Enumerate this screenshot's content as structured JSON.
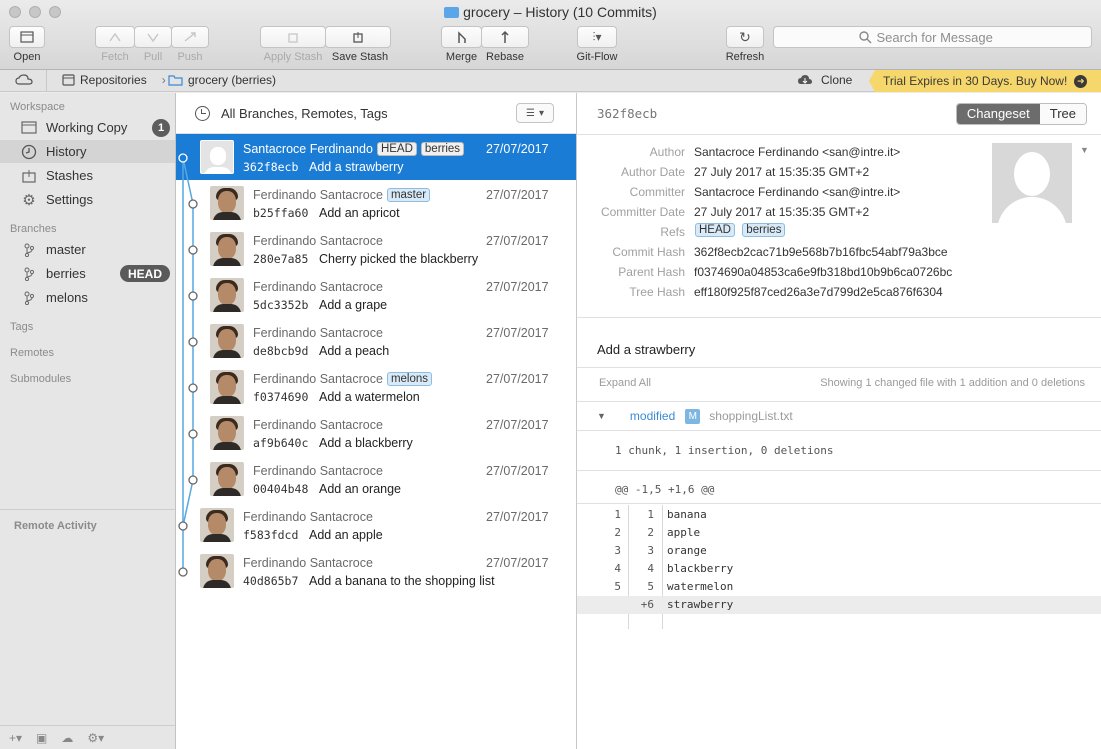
{
  "window": {
    "title": "grocery – History (10 Commits)"
  },
  "toolbar": {
    "open": "Open",
    "fetch": "Fetch",
    "pull": "Pull",
    "push": "Push",
    "apply_stash": "Apply Stash",
    "save_stash": "Save Stash",
    "merge": "Merge",
    "rebase": "Rebase",
    "gitflow": "Git-Flow",
    "refresh": "Refresh",
    "search_placeholder": "Search for Message"
  },
  "breadcrumb": {
    "repositories": "Repositories",
    "repo": "grocery (berries)",
    "clone": "Clone",
    "trial": "Trial Expires in 30 Days. Buy Now!"
  },
  "sidebar": {
    "workspace_title": "Workspace",
    "workspace": [
      {
        "label": "Working Copy",
        "badge": "1"
      },
      {
        "label": "History"
      },
      {
        "label": "Stashes"
      },
      {
        "label": "Settings"
      }
    ],
    "branches_title": "Branches",
    "branches": [
      {
        "label": "master"
      },
      {
        "label": "berries",
        "tag": "HEAD"
      },
      {
        "label": "melons"
      }
    ],
    "tags": "Tags",
    "remotes": "Remotes",
    "submodules": "Submodules",
    "remote_activity": "Remote Activity"
  },
  "history": {
    "filter": "All Branches, Remotes, Tags",
    "commits": [
      {
        "author": "Santacroce Ferdinando",
        "refs": [
          "HEAD",
          "berries"
        ],
        "date": "27/07/2017",
        "hash": "362f8ecb",
        "message": "Add a strawberry"
      },
      {
        "author": "Ferdinando Santacroce",
        "refs": [
          "master"
        ],
        "date": "27/07/2017",
        "hash": "b25ffa60",
        "message": "Add an apricot"
      },
      {
        "author": "Ferdinando Santacroce",
        "refs": [],
        "date": "27/07/2017",
        "hash": "280e7a85",
        "message": "Cherry picked the blackberry"
      },
      {
        "author": "Ferdinando Santacroce",
        "refs": [],
        "date": "27/07/2017",
        "hash": "5dc3352b",
        "message": "Add a grape"
      },
      {
        "author": "Ferdinando Santacroce",
        "refs": [],
        "date": "27/07/2017",
        "hash": "de8bcb9d",
        "message": "Add a peach"
      },
      {
        "author": "Ferdinando Santacroce",
        "refs": [
          "melons"
        ],
        "date": "27/07/2017",
        "hash": "f0374690",
        "message": "Add a watermelon"
      },
      {
        "author": "Ferdinando Santacroce",
        "refs": [],
        "date": "27/07/2017",
        "hash": "af9b640c",
        "message": "Add a blackberry"
      },
      {
        "author": "Ferdinando Santacroce",
        "refs": [],
        "date": "27/07/2017",
        "hash": "00404b48",
        "message": "Add an orange"
      },
      {
        "author": "Ferdinando Santacroce",
        "refs": [],
        "date": "27/07/2017",
        "hash": "f583fdcd",
        "message": "Add an apple"
      },
      {
        "author": "Ferdinando Santacroce",
        "refs": [],
        "date": "27/07/2017",
        "hash": "40d865b7",
        "message": "Add a banana to the shopping list"
      }
    ]
  },
  "detail": {
    "hash": "362f8ecb",
    "tabs": {
      "changeset": "Changeset",
      "tree": "Tree"
    },
    "labels": {
      "author": "Author",
      "author_date": "Author Date",
      "committer": "Committer",
      "committer_date": "Committer Date",
      "refs": "Refs",
      "commit_hash": "Commit Hash",
      "parent_hash": "Parent Hash",
      "tree_hash": "Tree Hash"
    },
    "author": "Santacroce Ferdinando <san@intre.it>",
    "author_date": "27 July 2017 at 15:35:35 GMT+2",
    "committer": "Santacroce Ferdinando <san@intre.it>",
    "committer_date": "27 July 2017 at 15:35:35 GMT+2",
    "refs": [
      "HEAD",
      "berries"
    ],
    "commit_hash": "362f8ecb2cac71b9e568b7b16fbc54abf79a3bce",
    "parent_hash": "f0374690a04853ca6e9fb318bd10b9b6ca0726bc",
    "tree_hash": "eff180f925f87ced26a3e7d799d2e5ca876f6304",
    "message": "Add a strawberry",
    "expand_all": "Expand All",
    "summary": "Showing 1 changed file with 1 addition and 0 deletions",
    "file_status": "modified",
    "file_badge": "M",
    "file_name": "shoppingList.txt",
    "chunk_info": "1 chunk, 1 insertion, 0 deletions",
    "hunk_header": "@@ -1,5 +1,6 @@",
    "lines": [
      {
        "old": "1",
        "new": "1",
        "text": "banana"
      },
      {
        "old": "2",
        "new": "2",
        "text": "apple"
      },
      {
        "old": "3",
        "new": "3",
        "text": "orange"
      },
      {
        "old": "4",
        "new": "4",
        "text": "blackberry"
      },
      {
        "old": "5",
        "new": "5",
        "text": "watermelon"
      },
      {
        "old": "",
        "new": "+6",
        "text": "strawberry",
        "added": true
      }
    ]
  },
  "colors": {
    "selection": "#1b7cd6",
    "trial_banner": "#f6d76b",
    "graph_line": "#57a7e0"
  }
}
